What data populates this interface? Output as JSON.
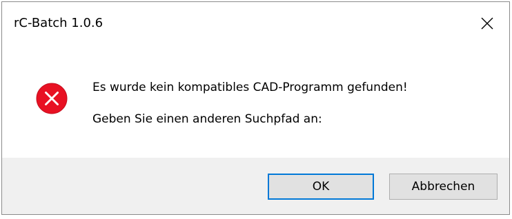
{
  "window": {
    "title": "rC-Batch 1.0.6",
    "close_icon": "close-icon"
  },
  "message": {
    "icon": "error-icon",
    "icon_color": "#e81123",
    "line1": "Es wurde kein kompatibles CAD-Programm gefunden!",
    "line2": "Geben Sie einen anderen Suchpfad an:"
  },
  "buttons": {
    "ok_label": "OK",
    "cancel_label": "Abbrechen",
    "default_accent": "#0078d7"
  }
}
